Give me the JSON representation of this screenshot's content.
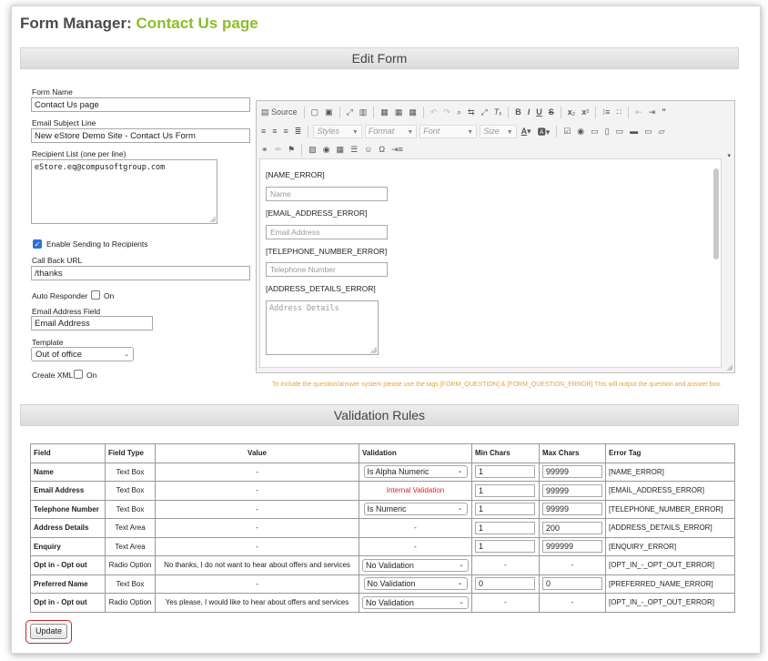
{
  "header": {
    "prefix": "Form Manager: ",
    "page": "Contact Us page"
  },
  "sections": {
    "edit": "Edit Form",
    "validation": "Validation Rules"
  },
  "form": {
    "form_name_label": "Form Name",
    "form_name_value": "Contact Us page",
    "subject_label": "Email Subject Line",
    "subject_value": "New eStore Demo Site - Contact Us Form",
    "recipient_label": "Recipient List (one per line)",
    "recipient_value": "eStore.eq@compusoftgroup.com",
    "enable_label": "Enable Sending to Recipients",
    "enable_checked": true,
    "callback_label": "Call Back URL",
    "callback_value": "/thanks",
    "auto_label": "Auto Responder",
    "auto_on": "On",
    "email_field_label": "Email Address Field",
    "email_field_value": "Email Address",
    "template_label": "Template",
    "template_value": "Out of office",
    "xml_label": "Create XML",
    "xml_on": "On"
  },
  "editor": {
    "toolbar": {
      "source": "Source",
      "styles": "Styles",
      "format": "Format",
      "font": "Font",
      "size": "Size",
      "icons_row1a": [
        "doc-icon",
        "preview-icon",
        "maximize-icon",
        "blocks-icon",
        "paste-icon",
        "paste-text-icon",
        "paste-word-icon",
        "undo-icon",
        "redo-icon",
        "find-icon",
        "replace-icon",
        "select-all-icon",
        "remove-format-icon"
      ],
      "icons_row1b": [
        "bold-icon",
        "italic-icon",
        "underline-icon",
        "strike-icon",
        "subscript-icon",
        "superscript-icon",
        "numbered-list-icon",
        "bulleted-list-icon",
        "outdent-icon",
        "indent-icon",
        "blockquote-icon"
      ],
      "icons_row3": [
        "link-icon",
        "unlink-icon",
        "anchor-icon",
        "image-icon",
        "flash-icon",
        "table-icon",
        "hr-icon",
        "smiley-icon",
        "special-char-icon",
        "pagebreak-icon"
      ]
    },
    "content": {
      "name_error": "[NAME_ERROR]",
      "name_ph": "Name",
      "email_error": "[EMAIL_ADDRESS_ERROR]",
      "email_ph": "Email Address",
      "tel_error": "[TELEPHONE_NUMBER_ERROR]",
      "tel_ph": "Telephone Number",
      "addr_error": "[ADDRESS_DETAILS_ERROR]",
      "addr_ph": "Address Details"
    }
  },
  "note": "To include the question/answer system please use the tags [FORM_QUESTION] & [FORM_QUESTION_ERROR] This will output the question and answer box.",
  "table": {
    "headers": [
      "Field",
      "Field Type",
      "Value",
      "Validation",
      "Min Chars",
      "Max Chars",
      "Error Tag"
    ],
    "rows": [
      {
        "field": "Name",
        "type": "Text Box",
        "value": "-",
        "validation": "Is Alpha Numeric",
        "vkind": "select",
        "min": "1",
        "max": "99999",
        "tag": "[NAME_ERROR]"
      },
      {
        "field": "Email Address",
        "type": "Text Box",
        "value": "-",
        "validation": "Internal Validation",
        "vkind": "text-red",
        "min": "1",
        "max": "99999",
        "tag": "[EMAIL_ADDRESS_ERROR]"
      },
      {
        "field": "Telephone Number",
        "type": "Text Box",
        "value": "-",
        "validation": "Is Numeric",
        "vkind": "select",
        "min": "1",
        "max": "99999",
        "tag": "[TELEPHONE_NUMBER_ERROR]"
      },
      {
        "field": "Address Details",
        "type": "Text Area",
        "value": "-",
        "validation": "-",
        "vkind": "text",
        "min": "1",
        "max": "200",
        "tag": "[ADDRESS_DETAILS_ERROR]"
      },
      {
        "field": "Enquiry",
        "type": "Text Area",
        "value": "-",
        "validation": "-",
        "vkind": "text",
        "min": "1",
        "max": "999999",
        "tag": "[ENQUIRY_ERROR]"
      },
      {
        "field": "Opt in - Opt out",
        "type": "Radio Option",
        "value": "No thanks, I do not want to hear about offers and services",
        "validation": "No Validation",
        "vkind": "select-wide",
        "min": "-",
        "max": "-",
        "tag": "[OPT_IN_-_OPT_OUT_ERROR]"
      },
      {
        "field": "Preferred Name",
        "type": "Text Box",
        "value": "-",
        "validation": "No Validation",
        "vkind": "select",
        "min": "0",
        "max": "0",
        "tag": "[PREFERRED_NAME_ERROR]"
      },
      {
        "field": "Opt in - Opt out",
        "type": "Radio Option",
        "value": "Yes please, I would like to hear about offers and services",
        "validation": "No Validation",
        "vkind": "select-wide",
        "min": "-",
        "max": "-",
        "tag": "[OPT_IN_-_OPT_OUT_ERROR]"
      }
    ]
  },
  "update_label": "Update",
  "colors": {
    "accent": "#8cbd2a",
    "error": "#d0282d",
    "note": "#e8a23a",
    "highlight": "#d11f2a",
    "checkbox": "#2f6fd6"
  }
}
